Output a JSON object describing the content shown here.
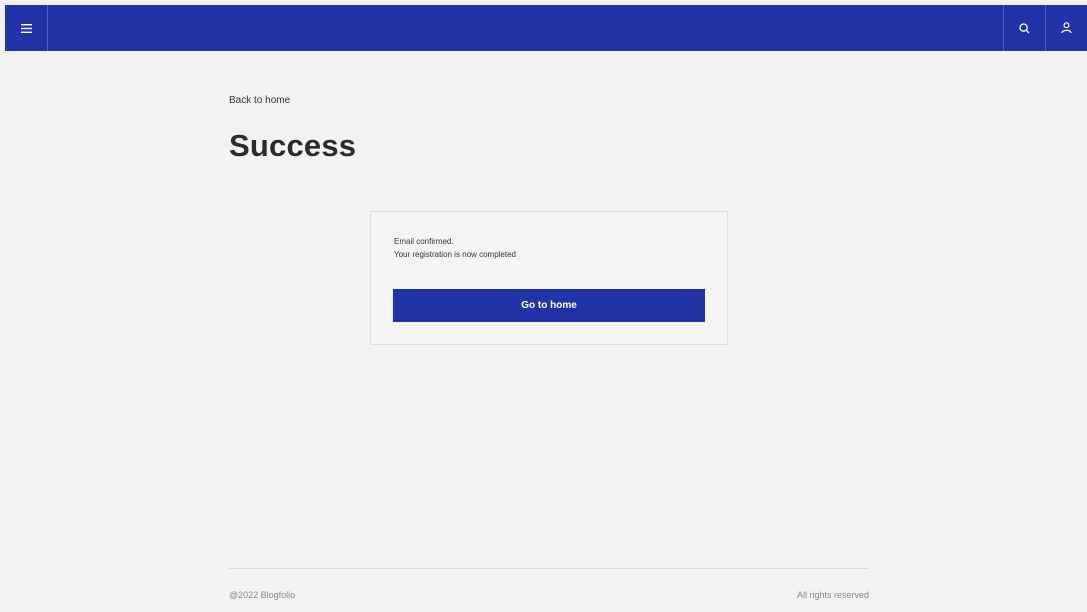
{
  "header": {
    "background": "#2233a8",
    "icons": [
      "hamburger-menu-icon",
      "search-icon",
      "user-icon"
    ]
  },
  "main": {
    "back_link": "Back to home",
    "title": "Success",
    "card": {
      "line1": "Email confirmed.",
      "line2": "Your registration is now completed",
      "button_label": "Go to home"
    }
  },
  "footer": {
    "copyright": "@2022 Blogfolio",
    "rights": "All rights reserved"
  }
}
